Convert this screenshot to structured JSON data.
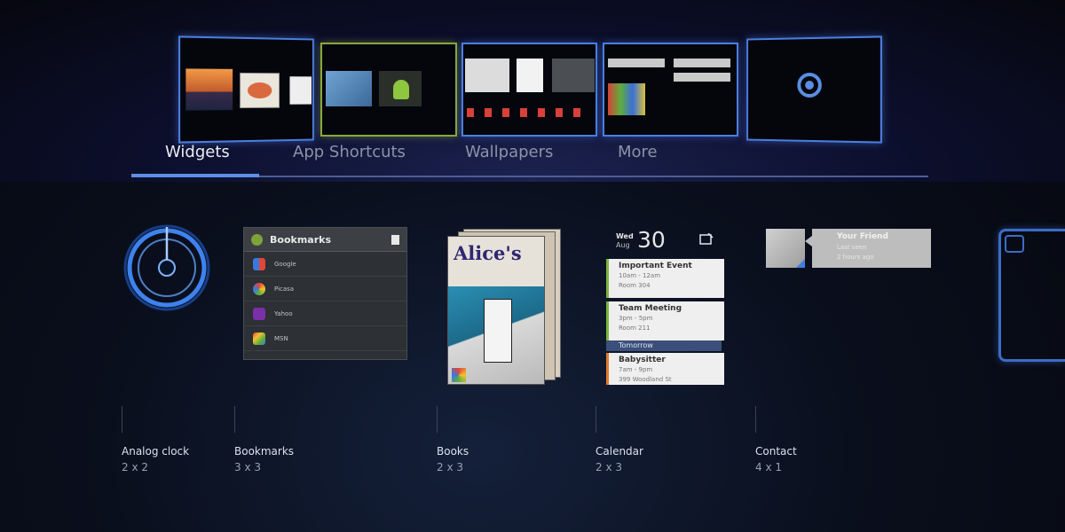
{
  "tabs": [
    {
      "label": "Widgets"
    },
    {
      "label": "App Shortcuts"
    },
    {
      "label": "Wallpapers"
    },
    {
      "label": "More"
    }
  ],
  "widgets": [
    {
      "name": "Analog clock",
      "size": "2 x 2"
    },
    {
      "name": "Bookmarks",
      "size": "3 x 3"
    },
    {
      "name": "Books",
      "size": "2 x 3"
    },
    {
      "name": "Calendar",
      "size": "2 x 3"
    },
    {
      "name": "Contact",
      "size": "4 x 1"
    }
  ],
  "bookmarks_widget": {
    "title": "Bookmarks",
    "items": [
      "Google",
      "Picasa",
      "Yahoo",
      "MSN"
    ]
  },
  "books_widget": {
    "cover_title": "Alice's"
  },
  "calendar_widget": {
    "day_name": "Wed",
    "month": "Aug",
    "day_number": "30",
    "divider": "Tomorrow",
    "events": [
      {
        "title": "Important Event",
        "time": "10am - 12am",
        "place": "Room 304"
      },
      {
        "title": "Team Meeting",
        "time": "3pm - 5pm",
        "place": "Room 211"
      },
      {
        "title": "Babysitter",
        "time": "7am - 9pm",
        "place": "399 Woodland St"
      }
    ]
  },
  "contact_widget": {
    "name": "Your Friend",
    "status": "Last seen",
    "time": "2 hours ago"
  },
  "colors": {
    "accent": "#5c8fe6",
    "active_screen": "#8aa83a",
    "screen_border": "#4c7ee0"
  }
}
